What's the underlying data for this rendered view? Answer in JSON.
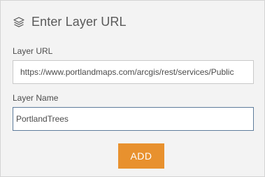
{
  "header": {
    "icon": "layers-icon",
    "title": "Enter Layer URL"
  },
  "form": {
    "url_label": "Layer URL",
    "url_value": "https://www.portlandmaps.com/arcgis/rest/services/Public",
    "name_label": "Layer Name",
    "name_value": "PortlandTrees",
    "add_button_label": "ADD"
  },
  "colors": {
    "panel_bg": "#f3f3f3",
    "accent_button": "#e8912e",
    "focused_border": "#5e7c9b"
  }
}
